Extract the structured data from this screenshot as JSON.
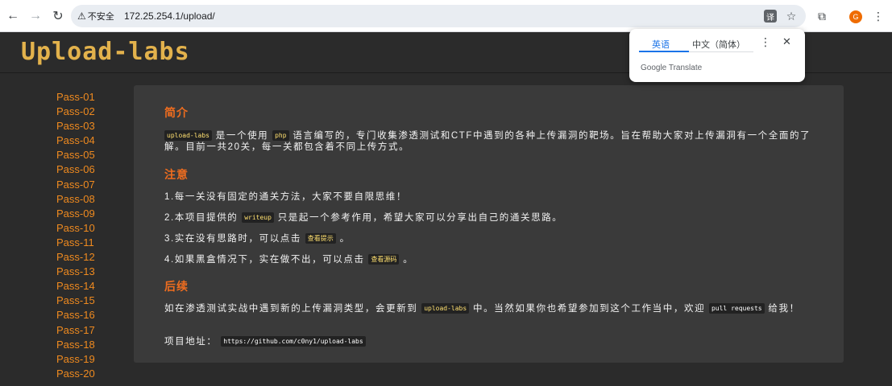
{
  "browser": {
    "security_label": "不安全",
    "url": "172.25.254.1/upload/",
    "avatar_letter": "G"
  },
  "translate": {
    "tab_source": "英语",
    "tab_target": "中文（简体）",
    "brand": "Google Translate"
  },
  "header": {
    "logo": "Upload-labs"
  },
  "sidebar": {
    "items": [
      "Pass-01",
      "Pass-02",
      "Pass-03",
      "Pass-04",
      "Pass-05",
      "Pass-06",
      "Pass-07",
      "Pass-08",
      "Pass-09",
      "Pass-10",
      "Pass-11",
      "Pass-12",
      "Pass-13",
      "Pass-14",
      "Pass-15",
      "Pass-16",
      "Pass-17",
      "Pass-18",
      "Pass-19",
      "Pass-20"
    ]
  },
  "main": {
    "intro_title": "简介",
    "intro_code1": "upload-labs",
    "intro_text1": "是一个使用",
    "intro_code2": "php",
    "intro_text2": "语言编写的，专门收集渗透测试和CTF中遇到的各种上传漏洞的靶场。旨在帮助大家对上传漏洞有一个全面的了解。目前一共20关，每一关都包含着不同上传方式。",
    "notes_title": "注意",
    "note1": "1.每一关没有固定的通关方法，大家不要自限思维！",
    "note2_a": "2.本项目提供的",
    "note2_code": "writeup",
    "note2_b": "只是起一个参考作用，希望大家可以分享出自己的通关思路。",
    "note3_a": "3.实在没有思路时，可以点击",
    "note3_code": "查看提示",
    "note3_b": "。",
    "note4_a": "4.如果黑盒情况下，实在做不出，可以点击",
    "note4_code": "查看源码",
    "note4_b": "。",
    "followup_title": "后续",
    "followup_a": "如在渗透测试实战中遇到新的上传漏洞类型，会更新到",
    "followup_code1": "upload-labs",
    "followup_b": "中。当然如果你也希望参加到这个工作当中，欢迎",
    "followup_code2": "pull requests",
    "followup_c": "给我！",
    "project_label": "项目地址：",
    "project_url": "https://github.com/c0ny1/upload-labs"
  }
}
